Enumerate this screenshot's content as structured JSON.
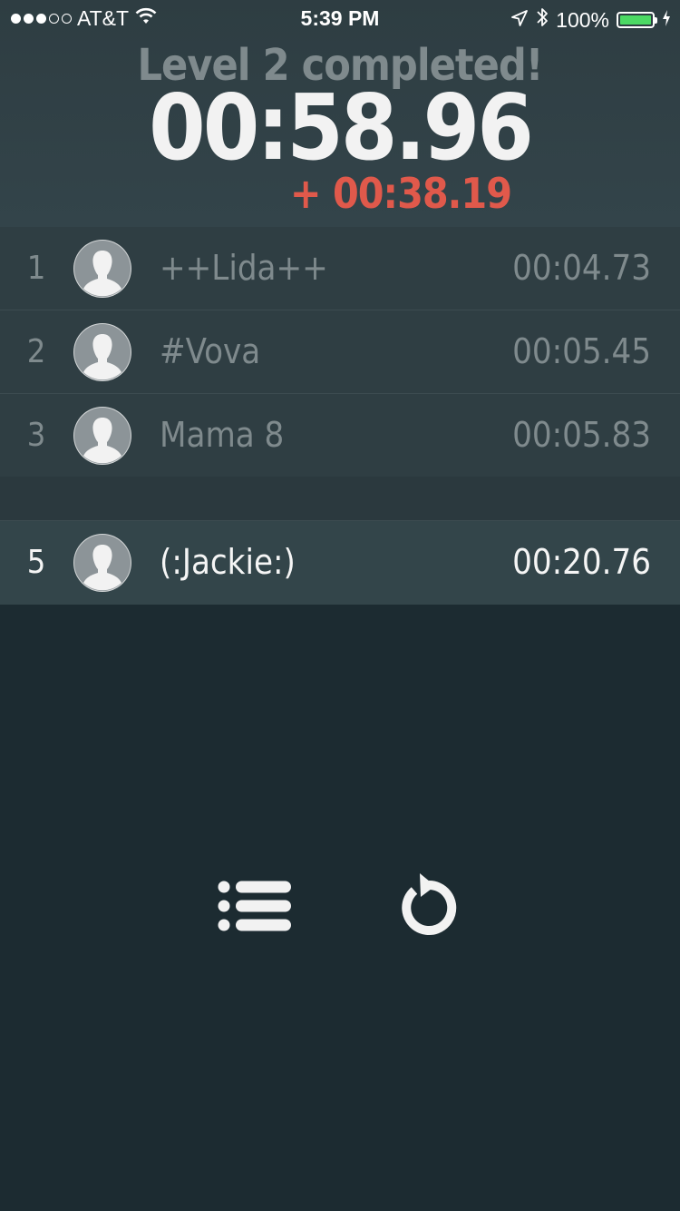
{
  "status_bar": {
    "signal_filled": 3,
    "signal_total": 5,
    "carrier": "AT&T",
    "time": "5:39 PM",
    "battery_percent": "100%",
    "battery_level": 1.0,
    "icons": [
      "wifi-icon",
      "location-arrow-icon",
      "bluetooth-icon",
      "battery-icon",
      "charging-bolt-icon"
    ]
  },
  "result": {
    "title": "Level 2 completed!",
    "time": "00:58.96",
    "delta": "+ 00:38.19",
    "delta_color": "#e0594b"
  },
  "leaderboard": [
    {
      "rank": "1",
      "name": "++Lida++",
      "time": "00:04.73",
      "avatar": "default-avatar-icon"
    },
    {
      "rank": "2",
      "name": "#Vova",
      "time": "00:05.45",
      "avatar": "default-avatar-icon"
    },
    {
      "rank": "3",
      "name": "Mama 8",
      "time": "00:05.83",
      "avatar": "default-avatar-icon"
    }
  ],
  "current_player": {
    "rank": "5",
    "name": "(:Jackie:)",
    "time": "00:20.76",
    "avatar": "default-avatar-icon"
  },
  "controls": {
    "list_icon": "list-icon",
    "restart_icon": "restart-icon"
  },
  "colors": {
    "background": "#1c2b31",
    "row": "#2f3e43",
    "muted_text": "#7f8a8d",
    "battery": "#4cd964"
  }
}
